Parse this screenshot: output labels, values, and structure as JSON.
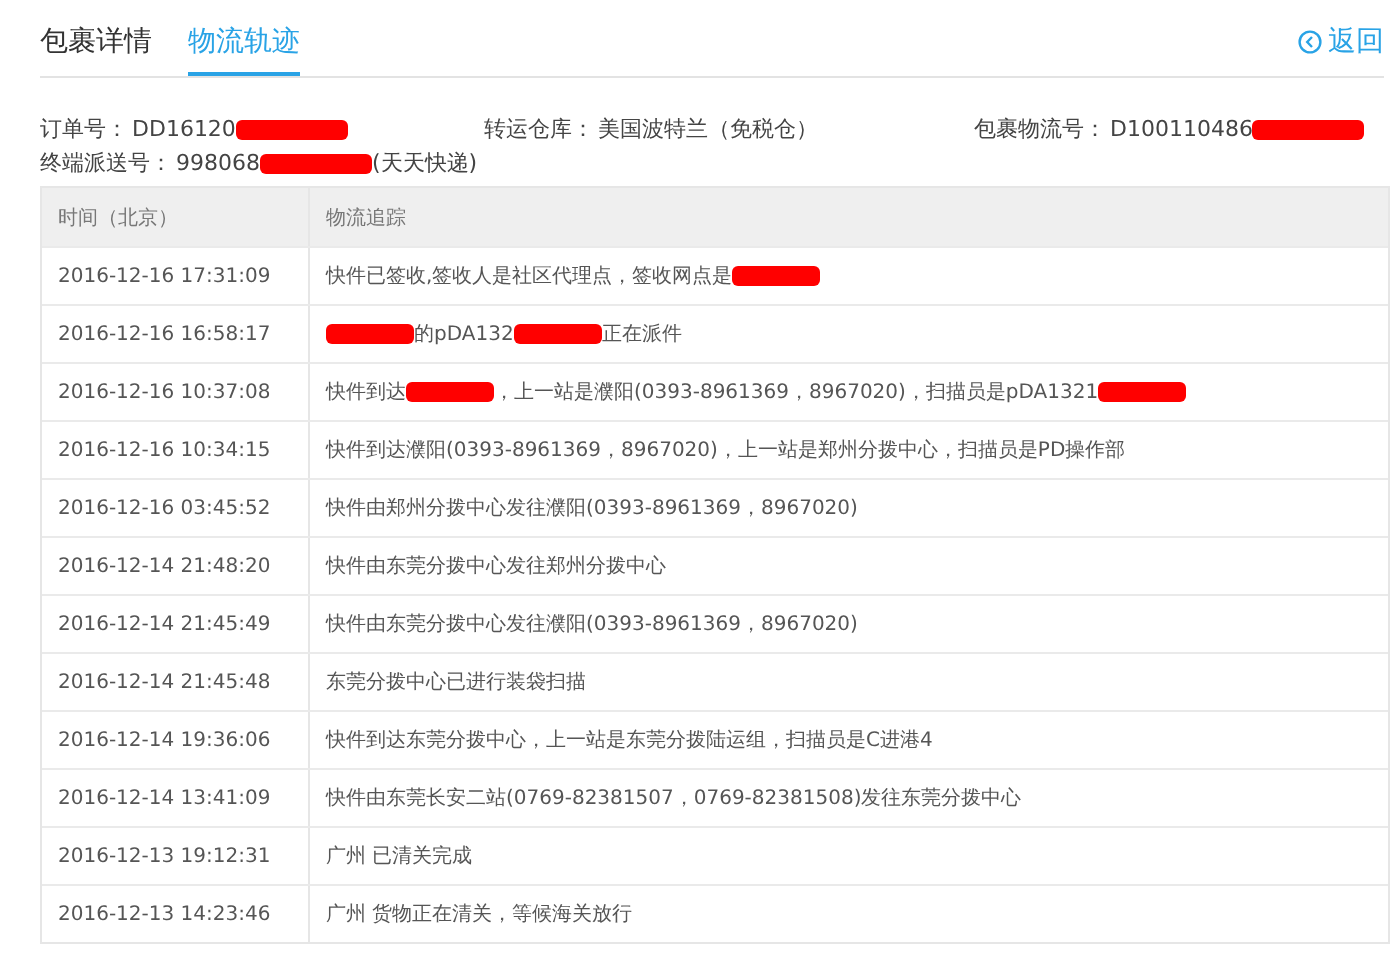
{
  "tabs": [
    {
      "label": "包裹详情",
      "selected": false
    },
    {
      "label": "物流轨迹",
      "selected": true
    }
  ],
  "back_link": {
    "label": "返回"
  },
  "info": [
    {
      "label": "订单号：",
      "value": [
        {
          "text": "DD16120"
        },
        {
          "redacted": true
        }
      ]
    },
    {
      "label": "转运仓库：",
      "value": [
        {
          "text": "美国波特兰（免税仓）"
        }
      ]
    },
    {
      "label": "包裹物流号：",
      "value": [
        {
          "text": "D100110486"
        },
        {
          "redacted": true
        }
      ]
    },
    {
      "label": "终端派送号：",
      "value": [
        {
          "text": "998068"
        },
        {
          "redacted": true
        },
        {
          "text": "(天天快递)"
        }
      ]
    }
  ],
  "table": {
    "columns": [
      "时间（北京）",
      "物流追踪"
    ],
    "rows": [
      {
        "time": "2016-12-16 17:31:09",
        "message": [
          {
            "text": "快件已签收,签收人是社区代理点，签收网点是"
          },
          {
            "redacted": true
          }
        ]
      },
      {
        "time": "2016-12-16 16:58:17",
        "message": [
          {
            "redacted": true
          },
          {
            "text": "的pDA132"
          },
          {
            "redacted": true
          },
          {
            "text": "正在派件"
          }
        ]
      },
      {
        "time": "2016-12-16 10:37:08",
        "message": [
          {
            "text": "快件到达"
          },
          {
            "redacted": true
          },
          {
            "text": "，上一站是濮阳(0393-8961369，8967020)，扫描员是pDA1321"
          },
          {
            "redacted": true
          }
        ]
      },
      {
        "time": "2016-12-16 10:34:15",
        "message": [
          {
            "text": "快件到达濮阳(0393-8961369，8967020)，上一站是郑州分拨中心，扫描员是PD操作部"
          }
        ]
      },
      {
        "time": "2016-12-16 03:45:52",
        "message": [
          {
            "text": "快件由郑州分拨中心发往濮阳(0393-8961369，8967020)"
          }
        ]
      },
      {
        "time": "2016-12-14 21:48:20",
        "message": [
          {
            "text": "快件由东莞分拨中心发往郑州分拨中心"
          }
        ]
      },
      {
        "time": "2016-12-14 21:45:49",
        "message": [
          {
            "text": "快件由东莞分拨中心发往濮阳(0393-8961369，8967020)"
          }
        ]
      },
      {
        "time": "2016-12-14 21:45:48",
        "message": [
          {
            "text": "东莞分拨中心已进行装袋扫描"
          }
        ]
      },
      {
        "time": "2016-12-14 19:36:06",
        "message": [
          {
            "text": "快件到达东莞分拨中心，上一站是东莞分拨陆运组，扫描员是C进港4"
          }
        ]
      },
      {
        "time": "2016-12-14 13:41:09",
        "message": [
          {
            "text": "快件由东莞长安二站(0769-82381507，0769-82381508)发往东莞分拨中心"
          }
        ]
      },
      {
        "time": "2016-12-13 19:12:31",
        "message": [
          {
            "text": "广州 已清关完成"
          }
        ]
      },
      {
        "time": "2016-12-13 14:23:46",
        "message": [
          {
            "text": "广州 货物正在清关，等候海关放行"
          }
        ]
      }
    ]
  }
}
